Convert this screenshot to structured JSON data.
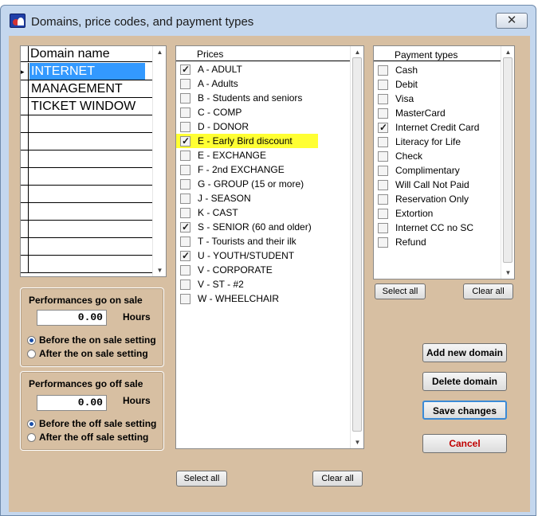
{
  "window": {
    "title": "Domains, price codes, and payment types",
    "close_glyph": "✕"
  },
  "domains": {
    "header": "Domain name",
    "current_marker": "▸",
    "rows": [
      "INTERNET",
      "MANAGEMENT",
      "TICKET WINDOW",
      "",
      "",
      "",
      "",
      "",
      "",
      "",
      "",
      ""
    ],
    "selected_index": 0
  },
  "on_sale": {
    "title": "Performances go on sale",
    "value": "0.00",
    "units": "Hours",
    "options": [
      "Before the on sale setting",
      "After the on sale setting"
    ],
    "selected": 0
  },
  "off_sale": {
    "title": "Performances go off sale",
    "value": "0.00",
    "units": "Hours",
    "options": [
      "Before the off sale setting",
      "After the off sale setting"
    ],
    "selected": 0
  },
  "prices": {
    "title": "Prices",
    "items": [
      {
        "label": "A - ADULT",
        "checked": true
      },
      {
        "label": "A - Adults",
        "checked": false
      },
      {
        "label": "B - Students and seniors",
        "checked": false
      },
      {
        "label": "C - COMP",
        "checked": false
      },
      {
        "label": "D - DONOR",
        "checked": false
      },
      {
        "label": "E - Early Bird discount",
        "checked": true,
        "highlight": true
      },
      {
        "label": "E - EXCHANGE",
        "checked": false
      },
      {
        "label": "F - 2nd EXCHANGE",
        "checked": false
      },
      {
        "label": "G - GROUP (15 or more)",
        "checked": false
      },
      {
        "label": "J - SEASON",
        "checked": false
      },
      {
        "label": "K - CAST",
        "checked": false
      },
      {
        "label": "S - SENIOR (60 and older)",
        "checked": true
      },
      {
        "label": "T - Tourists and their ilk",
        "checked": false
      },
      {
        "label": "U - YOUTH/STUDENT",
        "checked": true
      },
      {
        "label": "V - CORPORATE",
        "checked": false
      },
      {
        "label": "V - ST - #2",
        "checked": false
      },
      {
        "label": "W - WHEELCHAIR",
        "checked": false
      }
    ],
    "select_all": "Select all",
    "clear_all": "Clear all"
  },
  "payments": {
    "title": "Payment types",
    "items": [
      {
        "label": "Cash",
        "checked": false
      },
      {
        "label": "Debit",
        "checked": false
      },
      {
        "label": "Visa",
        "checked": false
      },
      {
        "label": "MasterCard",
        "checked": false
      },
      {
        "label": "Internet Credit Card",
        "checked": true
      },
      {
        "label": "Literacy for Life",
        "checked": false
      },
      {
        "label": "Check",
        "checked": false
      },
      {
        "label": "Complimentary",
        "checked": false
      },
      {
        "label": "Will Call Not Paid",
        "checked": false
      },
      {
        "label": "Reservation Only",
        "checked": false
      },
      {
        "label": "Extortion",
        "checked": false
      },
      {
        "label": "Internet CC no SC",
        "checked": false
      },
      {
        "label": "Refund",
        "checked": false
      }
    ],
    "select_all": "Select all",
    "clear_all": "Clear all"
  },
  "actions": {
    "add": "Add new domain",
    "delete": "Delete domain",
    "save": "Save changes",
    "cancel": "Cancel"
  },
  "colors": {
    "selection": "#3399ff",
    "highlight": "#ffff33",
    "client_bg": "#d7bfa2"
  }
}
